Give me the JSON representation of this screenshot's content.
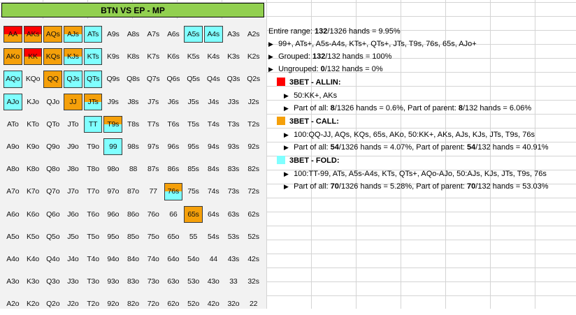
{
  "header": {
    "title": "BTN VS EP - MP"
  },
  "colors": {
    "allin": "#ff0000",
    "call": "#f5a00a",
    "fold": "#80ffff",
    "header": "#92d050"
  },
  "matrix": [
    [
      {
        "t": "AA",
        "a": 0.5,
        "c": 0.5,
        "f": 0
      },
      {
        "t": "AKs",
        "a": 0.5,
        "c": 0.5,
        "f": 0
      },
      {
        "t": "AQs",
        "a": 0,
        "c": 1,
        "f": 0
      },
      {
        "t": "AJs",
        "a": 0,
        "c": 0.5,
        "f": 0.5
      },
      {
        "t": "ATs",
        "a": 0,
        "c": 0,
        "f": 1
      },
      {
        "t": "A9s"
      },
      {
        "t": "A8s"
      },
      {
        "t": "A7s"
      },
      {
        "t": "A6s"
      },
      {
        "t": "A5s",
        "a": 0,
        "c": 0,
        "f": 1
      },
      {
        "t": "A4s",
        "a": 0,
        "c": 0,
        "f": 1
      },
      {
        "t": "A3s"
      },
      {
        "t": "A2s"
      }
    ],
    [
      {
        "t": "AKo",
        "a": 0,
        "c": 1,
        "f": 0
      },
      {
        "t": "KK",
        "a": 0.5,
        "c": 0.5,
        "f": 0
      },
      {
        "t": "KQs",
        "a": 0,
        "c": 1,
        "f": 0
      },
      {
        "t": "KJs",
        "a": 0,
        "c": 0.5,
        "f": 0.5
      },
      {
        "t": "KTs",
        "a": 0,
        "c": 0,
        "f": 1
      },
      {
        "t": "K9s"
      },
      {
        "t": "K8s"
      },
      {
        "t": "K7s"
      },
      {
        "t": "K6s"
      },
      {
        "t": "K5s"
      },
      {
        "t": "K4s"
      },
      {
        "t": "K3s"
      },
      {
        "t": "K2s"
      }
    ],
    [
      {
        "t": "AQo",
        "a": 0,
        "c": 0,
        "f": 1
      },
      {
        "t": "KQo"
      },
      {
        "t": "QQ",
        "a": 0,
        "c": 1,
        "f": 0
      },
      {
        "t": "QJs",
        "a": 0,
        "c": 0,
        "f": 1
      },
      {
        "t": "QTs",
        "a": 0,
        "c": 0,
        "f": 1
      },
      {
        "t": "Q9s"
      },
      {
        "t": "Q8s"
      },
      {
        "t": "Q7s"
      },
      {
        "t": "Q6s"
      },
      {
        "t": "Q5s"
      },
      {
        "t": "Q4s"
      },
      {
        "t": "Q3s"
      },
      {
        "t": "Q2s"
      }
    ],
    [
      {
        "t": "AJo",
        "a": 0,
        "c": 0,
        "f": 1
      },
      {
        "t": "KJo"
      },
      {
        "t": "QJo"
      },
      {
        "t": "JJ",
        "a": 0,
        "c": 1,
        "f": 0
      },
      {
        "t": "JTs",
        "a": 0,
        "c": 0.5,
        "f": 0.5
      },
      {
        "t": "J9s"
      },
      {
        "t": "J8s"
      },
      {
        "t": "J7s"
      },
      {
        "t": "J6s"
      },
      {
        "t": "J5s"
      },
      {
        "t": "J4s"
      },
      {
        "t": "J3s"
      },
      {
        "t": "J2s"
      }
    ],
    [
      {
        "t": "ATo"
      },
      {
        "t": "KTo"
      },
      {
        "t": "QTo"
      },
      {
        "t": "JTo"
      },
      {
        "t": "TT",
        "a": 0,
        "c": 0,
        "f": 1
      },
      {
        "t": "T9s",
        "a": 0,
        "c": 0.5,
        "f": 0.5
      },
      {
        "t": "T8s"
      },
      {
        "t": "T7s"
      },
      {
        "t": "T6s"
      },
      {
        "t": "T5s"
      },
      {
        "t": "T4s"
      },
      {
        "t": "T3s"
      },
      {
        "t": "T2s"
      }
    ],
    [
      {
        "t": "A9o"
      },
      {
        "t": "K9o"
      },
      {
        "t": "Q9o"
      },
      {
        "t": "J9o"
      },
      {
        "t": "T9o"
      },
      {
        "t": "99",
        "a": 0,
        "c": 0,
        "f": 1
      },
      {
        "t": "98s"
      },
      {
        "t": "97s"
      },
      {
        "t": "96s"
      },
      {
        "t": "95s"
      },
      {
        "t": "94s"
      },
      {
        "t": "93s"
      },
      {
        "t": "92s"
      }
    ],
    [
      {
        "t": "A8o"
      },
      {
        "t": "K8o"
      },
      {
        "t": "Q8o"
      },
      {
        "t": "J8o"
      },
      {
        "t": "T8o"
      },
      {
        "t": "98o"
      },
      {
        "t": "88"
      },
      {
        "t": "87s"
      },
      {
        "t": "86s"
      },
      {
        "t": "85s"
      },
      {
        "t": "84s"
      },
      {
        "t": "83s"
      },
      {
        "t": "82s"
      }
    ],
    [
      {
        "t": "A7o"
      },
      {
        "t": "K7o"
      },
      {
        "t": "Q7o"
      },
      {
        "t": "J7o"
      },
      {
        "t": "T7o"
      },
      {
        "t": "97o"
      },
      {
        "t": "87o"
      },
      {
        "t": "77"
      },
      {
        "t": "76s",
        "a": 0,
        "c": 0.5,
        "f": 0.5
      },
      {
        "t": "75s"
      },
      {
        "t": "74s"
      },
      {
        "t": "73s"
      },
      {
        "t": "72s"
      }
    ],
    [
      {
        "t": "A6o"
      },
      {
        "t": "K6o"
      },
      {
        "t": "Q6o"
      },
      {
        "t": "J6o"
      },
      {
        "t": "T6o"
      },
      {
        "t": "96o"
      },
      {
        "t": "86o"
      },
      {
        "t": "76o"
      },
      {
        "t": "66"
      },
      {
        "t": "65s",
        "a": 0,
        "c": 1,
        "f": 0
      },
      {
        "t": "64s"
      },
      {
        "t": "63s"
      },
      {
        "t": "62s"
      }
    ],
    [
      {
        "t": "A5o"
      },
      {
        "t": "K5o"
      },
      {
        "t": "Q5o"
      },
      {
        "t": "J5o"
      },
      {
        "t": "T5o"
      },
      {
        "t": "95o"
      },
      {
        "t": "85o"
      },
      {
        "t": "75o"
      },
      {
        "t": "65o"
      },
      {
        "t": "55"
      },
      {
        "t": "54s"
      },
      {
        "t": "53s"
      },
      {
        "t": "52s"
      }
    ],
    [
      {
        "t": "A4o"
      },
      {
        "t": "K4o"
      },
      {
        "t": "Q4o"
      },
      {
        "t": "J4o"
      },
      {
        "t": "T4o"
      },
      {
        "t": "94o"
      },
      {
        "t": "84o"
      },
      {
        "t": "74o"
      },
      {
        "t": "64o"
      },
      {
        "t": "54o"
      },
      {
        "t": "44"
      },
      {
        "t": "43s"
      },
      {
        "t": "42s"
      }
    ],
    [
      {
        "t": "A3o"
      },
      {
        "t": "K3o"
      },
      {
        "t": "Q3o"
      },
      {
        "t": "J3o"
      },
      {
        "t": "T3o"
      },
      {
        "t": "93o"
      },
      {
        "t": "83o"
      },
      {
        "t": "73o"
      },
      {
        "t": "63o"
      },
      {
        "t": "53o"
      },
      {
        "t": "43o"
      },
      {
        "t": "33"
      },
      {
        "t": "32s"
      }
    ],
    [
      {
        "t": "A2o"
      },
      {
        "t": "K2o"
      },
      {
        "t": "Q2o"
      },
      {
        "t": "J2o"
      },
      {
        "t": "T2o"
      },
      {
        "t": "92o"
      },
      {
        "t": "82o"
      },
      {
        "t": "72o"
      },
      {
        "t": "62o"
      },
      {
        "t": "52o"
      },
      {
        "t": "42o"
      },
      {
        "t": "32o"
      },
      {
        "t": "22"
      }
    ]
  ],
  "summary": {
    "entire_prefix": "Entire range: ",
    "entire_count": "132",
    "entire_suffix": "/1326 hands = 9.95%",
    "range_list": "99+, ATs+, A5s-A4s, KTs+, QTs+, JTs, T9s, 76s, 65s, AJo+",
    "grouped_prefix": "Grouped: ",
    "grouped_count": "132",
    "grouped_suffix": "/132 hands = 100%",
    "ungrouped_prefix": "Ungrouped: ",
    "ungrouped_count": "0",
    "ungrouped_suffix": "/132 hands = 0%"
  },
  "groups": [
    {
      "title": "3BET - ALLIN:",
      "hands": "50:KK+, AKs",
      "part_all_prefix": "Part of all: ",
      "part_all_count": "8",
      "part_all_mid": "/1326 hands = 0.6%, Part of parent: ",
      "part_parent_count": "8",
      "part_parent_suffix": "/132 hands = 6.06%"
    },
    {
      "title": "3BET - CALL:",
      "hands": "100:QQ-JJ, AQs, KQs, 65s, AKo, 50:KK+, AKs, AJs, KJs, JTs, T9s, 76s",
      "part_all_prefix": "Part of all: ",
      "part_all_count": "54",
      "part_all_mid": "/1326 hands = 4.07%, Part of parent: ",
      "part_parent_count": "54",
      "part_parent_suffix": "/132 hands = 40.91%"
    },
    {
      "title": "3BET - FOLD:",
      "hands": "100:TT-99, ATs, A5s-A4s, KTs, QTs+, AQo-AJo, 50:AJs, KJs, JTs, T9s, 76s",
      "part_all_prefix": "Part of all: ",
      "part_all_count": "70",
      "part_all_mid": "/1326 hands = 5.28%, Part of parent: ",
      "part_parent_count": "70",
      "part_parent_suffix": "/132 hands = 53.03%"
    }
  ],
  "icons": {
    "bullet": "triangle-right-icon",
    "swatch": "color-swatch-icon"
  }
}
